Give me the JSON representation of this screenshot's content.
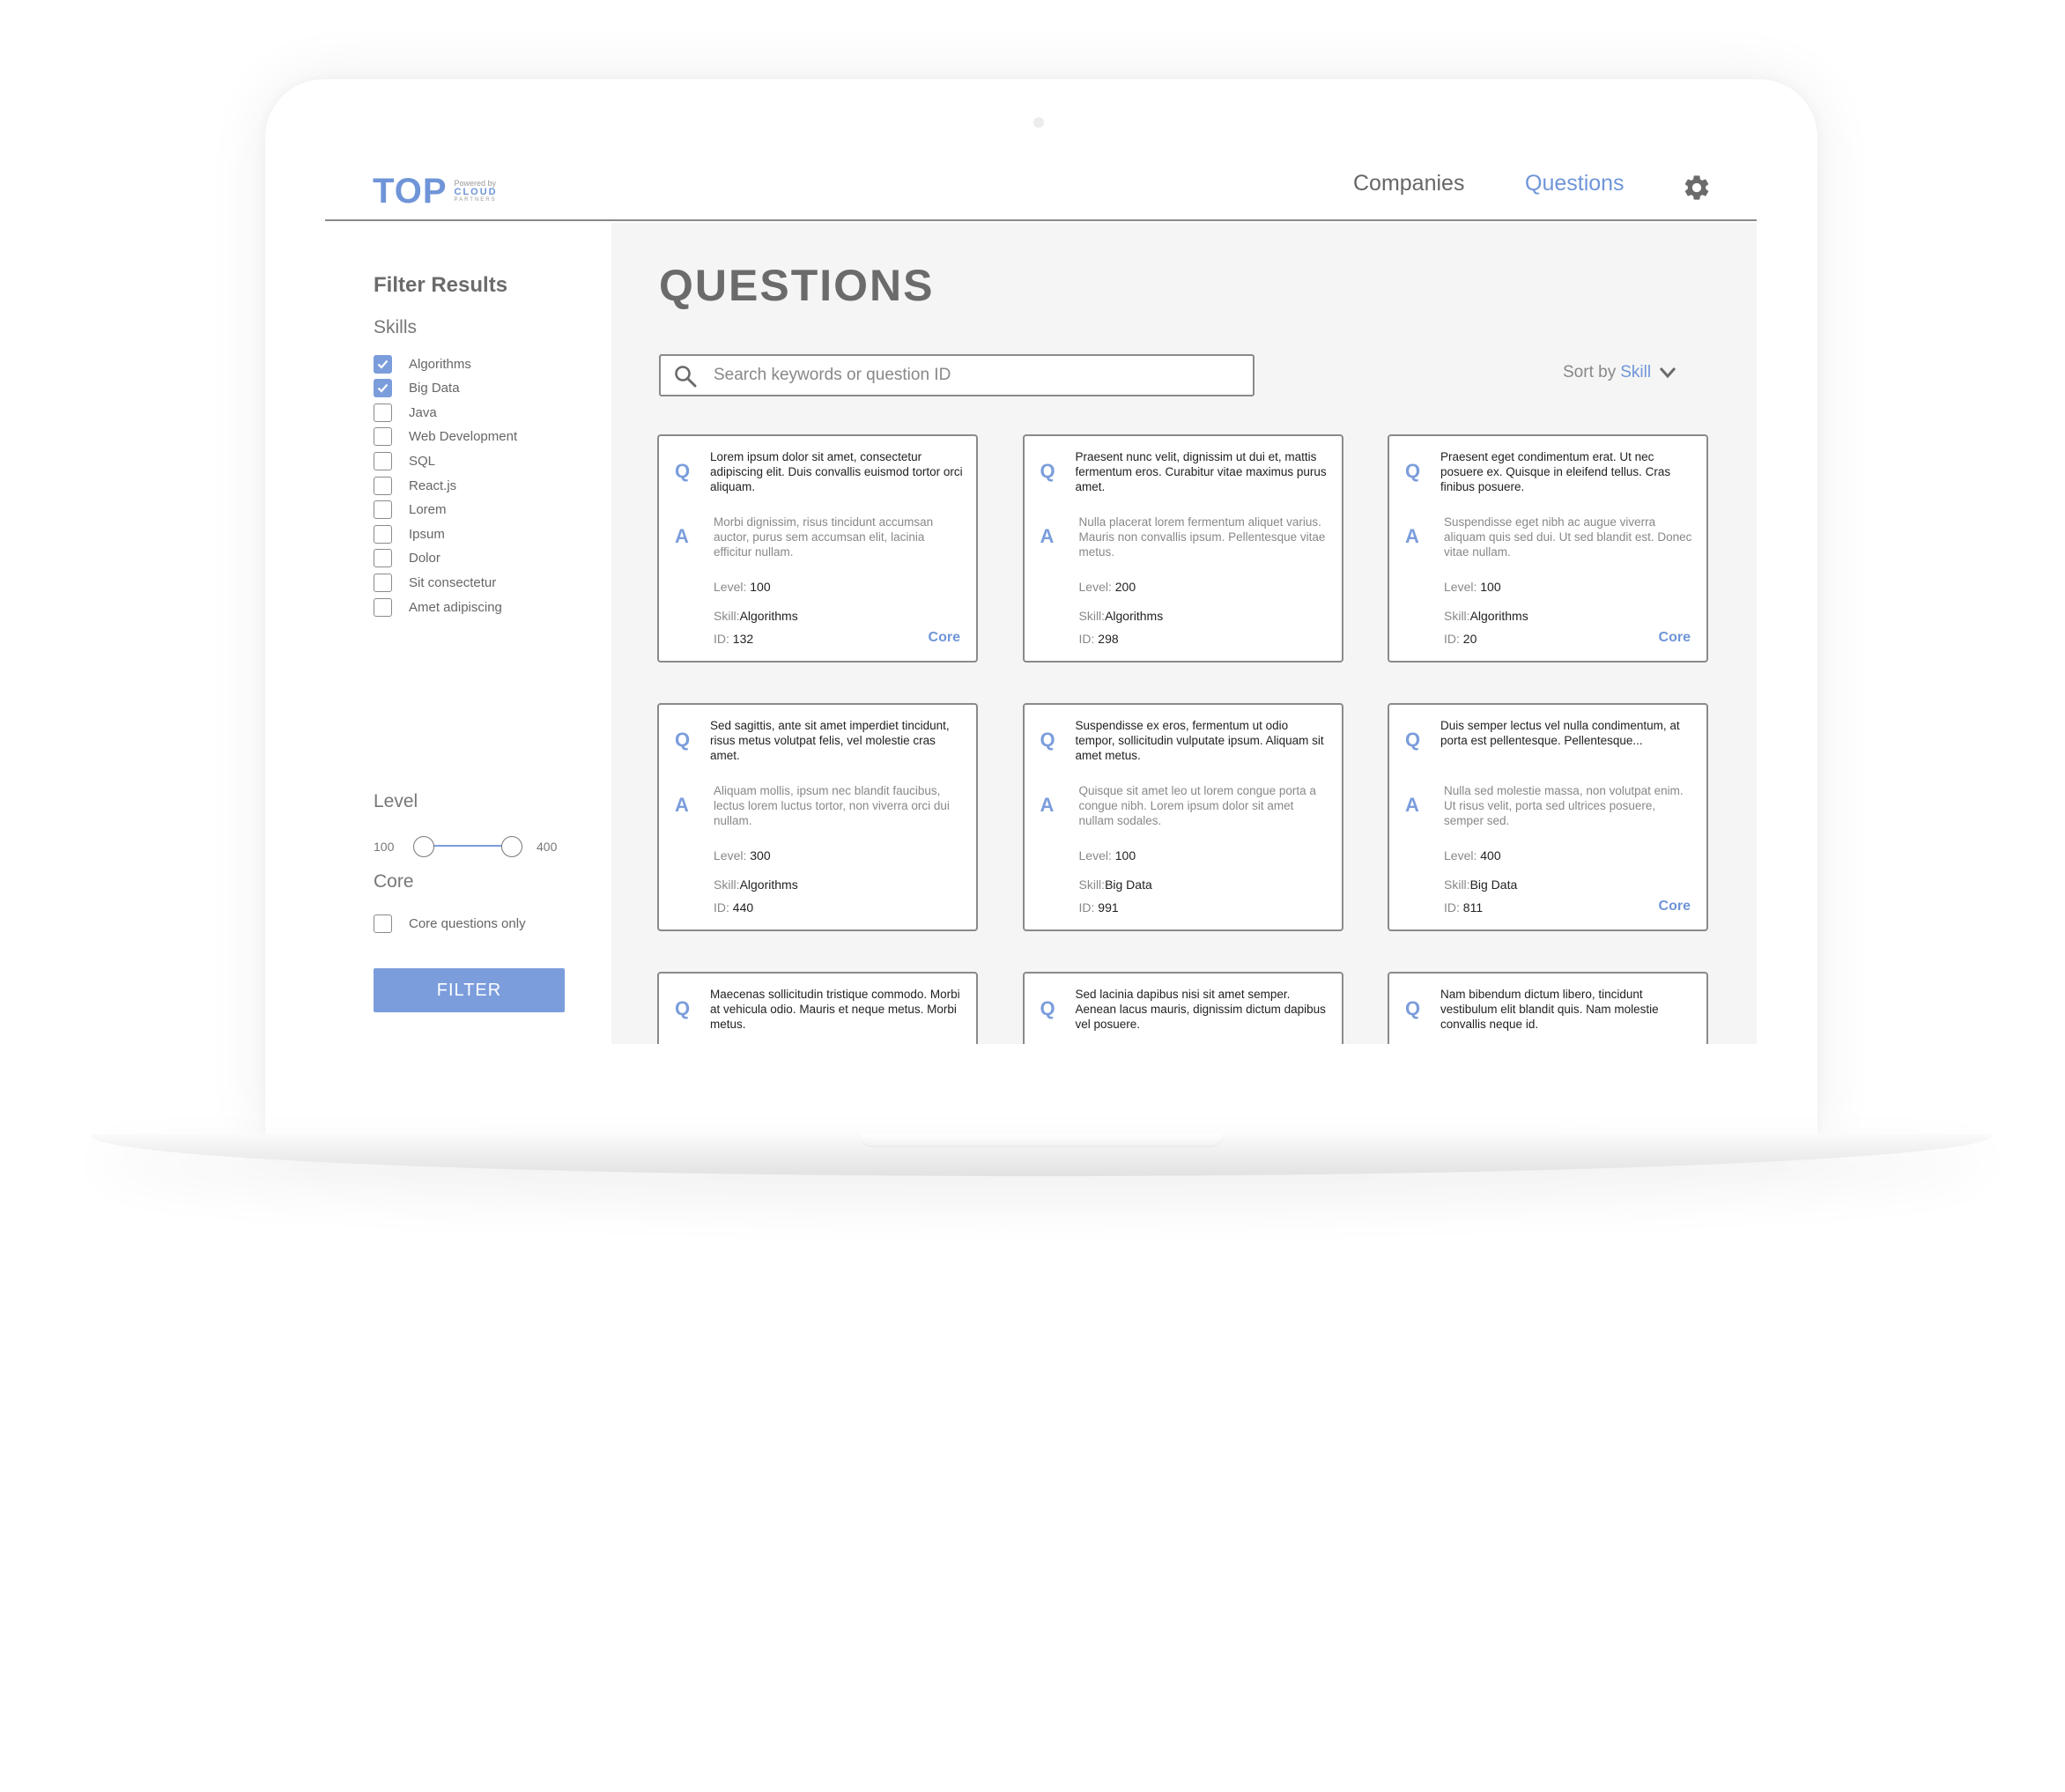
{
  "logo": {
    "text": "TOP",
    "powered_by": "Powered by",
    "brand": "CLOUD",
    "brand_sub": "PARTNERS"
  },
  "nav": {
    "companies": "Companies",
    "questions": "Questions",
    "settings_icon": "gear-icon"
  },
  "sidebar": {
    "title": "Filter Results",
    "skills_label": "Skills",
    "skills": [
      {
        "label": "Algorithms",
        "checked": true
      },
      {
        "label": "Big Data",
        "checked": true
      },
      {
        "label": "Java",
        "checked": false
      },
      {
        "label": "Web Development",
        "checked": false
      },
      {
        "label": "SQL",
        "checked": false
      },
      {
        "label": "React.js",
        "checked": false
      },
      {
        "label": "Lorem",
        "checked": false
      },
      {
        "label": "Ipsum",
        "checked": false
      },
      {
        "label": "Dolor",
        "checked": false
      },
      {
        "label": "Sit consectetur",
        "checked": false
      },
      {
        "label": "Amet adipiscing",
        "checked": false
      }
    ],
    "level_label": "Level",
    "level_min": "100",
    "level_max": "400",
    "core_label": "Core",
    "core_only_label": "Core questions only",
    "core_only_checked": false,
    "filter_button": "FILTER"
  },
  "main": {
    "title": "QUESTIONS",
    "search_placeholder": "Search keywords or question ID",
    "sort_prefix": "Sort by",
    "sort_value": "Skill"
  },
  "colors": {
    "accent": "#7b9ddc",
    "link": "#6f95d8",
    "text_dark": "#222222",
    "text_muted": "#888888"
  },
  "cards": [
    {
      "q": "Lorem ipsum dolor sit amet, consectetur adipiscing elit. Duis convallis euismod tortor orci aliquam.",
      "a": "Morbi dignissim, risus tincidunt accumsan auctor, purus sem accumsan elit, lacinia efficitur nullam.",
      "level": "100",
      "skill": "Algorithms",
      "id": "132",
      "core": "Core"
    },
    {
      "q": "Praesent nunc velit, dignissim ut dui et, mattis fermentum eros. Curabitur vitae maximus purus amet.",
      "a": "Nulla placerat lorem fermentum aliquet varius. Mauris non convallis ipsum. Pellentesque vitae metus.",
      "level": "200",
      "skill": "Algorithms",
      "id": "298",
      "core": ""
    },
    {
      "q": "Praesent eget condimentum erat. Ut nec posuere ex. Quisque in eleifend tellus. Cras finibus posuere.",
      "a": "Suspendisse eget nibh ac augue viverra aliquam quis sed dui. Ut sed blandit est. Donec vitae nullam.",
      "level": "100",
      "skill": "Algorithms",
      "id": "20",
      "core": "Core"
    },
    {
      "q": "Sed sagittis, ante sit amet imperdiet tincidunt, risus metus volutpat felis, vel molestie cras amet.",
      "a": "Aliquam mollis, ipsum nec blandit faucibus, lectus lorem luctus tortor, non viverra orci dui nullam.",
      "level": "300",
      "skill": "Algorithms",
      "id": "440",
      "core": ""
    },
    {
      "q": "Suspendisse ex eros, fermentum ut odio tempor, sollicitudin vulputate ipsum. Aliquam sit amet metus.",
      "a": "Quisque sit amet leo ut lorem congue porta a congue nibh. Lorem ipsum dolor sit amet nullam sodales.",
      "level": "100",
      "skill": "Big Data",
      "id": "991",
      "core": ""
    },
    {
      "q": "Duis semper lectus vel nulla condimentum, at porta est pellentesque. Pellentesque...",
      "a": "Nulla sed molestie massa, non volutpat enim. Ut risus velit, porta sed ultrices posuere, semper sed.",
      "level": "400",
      "skill": "Big Data",
      "id": "811",
      "core": "Core"
    },
    {
      "q": "Maecenas sollicitudin tristique commodo. Morbi at vehicula odio. Mauris et neque metus. Morbi metus.",
      "a": "",
      "level": "",
      "skill": "",
      "id": "",
      "core": ""
    },
    {
      "q": "Sed lacinia dapibus nisi sit amet semper. Aenean lacus mauris, dignissim dictum dapibus vel posuere.",
      "a": "",
      "level": "",
      "skill": "",
      "id": "",
      "core": ""
    },
    {
      "q": "Nam bibendum dictum libero, tincidunt vestibulum elit blandit quis. Nam molestie convallis neque id.",
      "a": "",
      "level": "",
      "skill": "",
      "id": "",
      "core": ""
    }
  ],
  "card_labels": {
    "q_letter": "Q",
    "a_letter": "A",
    "level": "Level:",
    "skill": "Skill:",
    "id": "ID:"
  }
}
